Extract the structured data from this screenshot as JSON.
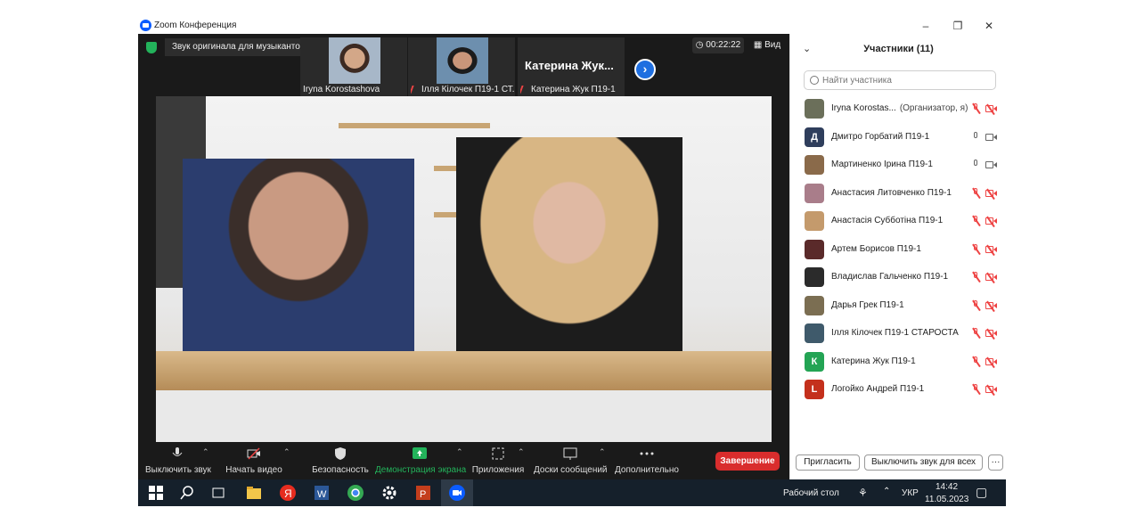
{
  "window": {
    "title": "Zoom Конференция",
    "controls": [
      "minimize",
      "restore",
      "close"
    ]
  },
  "meeting": {
    "banner": "Звук оригинала для музыкантов выключен",
    "thumbnails": [
      {
        "name": "Iryna Korostashova",
        "muted": false
      },
      {
        "name": "Ілля Кілочек П19-1 СТ...",
        "muted": true
      },
      {
        "name": "Катерина Жук П19-1",
        "muted": true,
        "big_label": "Катерина  Жук..."
      }
    ],
    "timer": "00:22:22",
    "view_label": "Вид"
  },
  "toolbar": {
    "mute": "Выключить звук",
    "video": "Начать видео",
    "security": "Безопасность",
    "share": "Демонстрация экрана",
    "apps": "Приложения",
    "whiteboards": "Доски сообщений",
    "more": "Дополнительно",
    "end": "Завершение"
  },
  "colors": {
    "share_green": "#23b35b",
    "end_red": "#d92d2d",
    "muted_red": "#e44444",
    "zoom_blue": "#0b5cff"
  },
  "participants": {
    "title": "Участники (11)",
    "search_placeholder": "Найти участника",
    "list": [
      {
        "name": "Iryna Korostas...",
        "role": "(Организатор, я)",
        "initial": "",
        "avatar_color": "#6b6f5a",
        "mic": "muted",
        "cam": "off"
      },
      {
        "name": "Дмитро Горбатий П19-1",
        "role": "",
        "initial": "Д",
        "avatar_color": "#2f3e5c",
        "mic": "on",
        "cam": "on"
      },
      {
        "name": "Мартиненко Ірина П19-1",
        "role": "",
        "initial": "",
        "avatar_color": "#8a6a4a",
        "mic": "on",
        "cam": "on"
      },
      {
        "name": "Анастасия Литовченко П19-1",
        "role": "",
        "initial": "",
        "avatar_color": "#a97d8a",
        "mic": "muted",
        "cam": "off"
      },
      {
        "name": "Анастасія Субботіна П19-1",
        "role": "",
        "initial": "",
        "avatar_color": "#c49a6c",
        "mic": "muted",
        "cam": "off"
      },
      {
        "name": "Артем Борисов П19-1",
        "role": "",
        "initial": "",
        "avatar_color": "#5a2a2a",
        "mic": "muted",
        "cam": "off"
      },
      {
        "name": "Владислав Гальченко П19-1",
        "role": "",
        "initial": "",
        "avatar_color": "#2b2b2b",
        "mic": "muted",
        "cam": "off"
      },
      {
        "name": "Дарья Грек П19-1",
        "role": "",
        "initial": "",
        "avatar_color": "#7b6e52",
        "mic": "muted",
        "cam": "off"
      },
      {
        "name": "Ілля Кілочек П19-1 СТАРОСТА",
        "role": "",
        "initial": "",
        "avatar_color": "#3f5a6b",
        "mic": "muted",
        "cam": "off"
      },
      {
        "name": "Катерина Жук П19-1",
        "role": "",
        "initial": "К",
        "avatar_color": "#23a454",
        "mic": "muted",
        "cam": "off"
      },
      {
        "name": "Логойко Андрей П19-1",
        "role": "",
        "initial": "L",
        "avatar_color": "#c4301c",
        "mic": "muted",
        "cam": "off"
      }
    ],
    "invite": "Пригласить",
    "mute_all": "Выключить звук для всех",
    "more": "···"
  },
  "taskbar": {
    "desktop_label": "Рабочий стол",
    "lang": "УКР",
    "time": "14:42",
    "date": "11.05.2023"
  }
}
